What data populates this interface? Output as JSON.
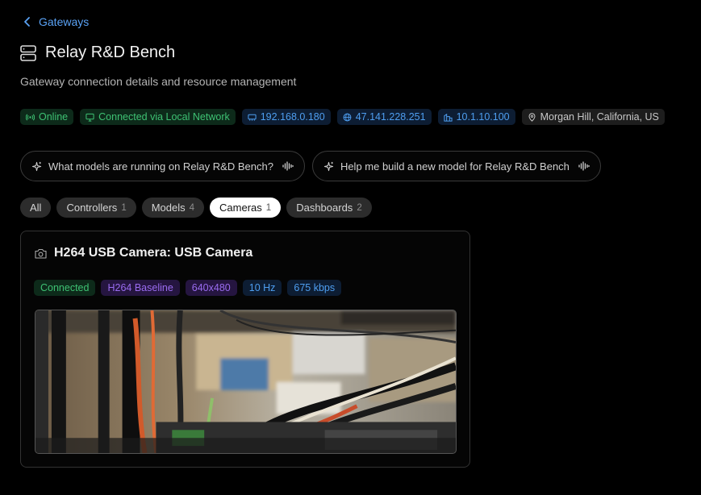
{
  "nav": {
    "back_label": "Gateways",
    "back_icon": "chevron-left-icon"
  },
  "header": {
    "title": "Relay R&D Bench",
    "icon": "server-icon",
    "subtitle": "Gateway connection details and resource management"
  },
  "status_badges": [
    {
      "label": "Online",
      "icon": "broadcast-icon",
      "color": "#3ec173"
    },
    {
      "label": "Connected via Local Network",
      "icon": "monitor-icon",
      "color": "#3ec173"
    },
    {
      "label": "192.168.0.180",
      "icon": "network-card-icon",
      "color": "#4e9ef0"
    },
    {
      "label": "47.141.228.251",
      "icon": "globe-icon",
      "color": "#4e9ef0"
    },
    {
      "label": "10.1.10.100",
      "icon": "building-icon",
      "color": "#4e9ef0"
    },
    {
      "label": "Morgan Hill, California, US",
      "icon": "map-pin-icon",
      "color": "#c8c8c8"
    }
  ],
  "prompts": [
    {
      "label": "What models are running on Relay R&D Bench?"
    },
    {
      "label": "Help me build a new model for Relay R&D Bench"
    }
  ],
  "tabs": [
    {
      "label": "All",
      "count": "",
      "active": false
    },
    {
      "label": "Controllers",
      "count": "1",
      "active": false
    },
    {
      "label": "Models",
      "count": "4",
      "active": false
    },
    {
      "label": "Cameras",
      "count": "1",
      "active": true
    },
    {
      "label": "Dashboards",
      "count": "2",
      "active": false
    }
  ],
  "camera_card": {
    "title": "H264 USB Camera: USB Camera",
    "icon": "camera-icon",
    "badges": [
      {
        "label": "Connected",
        "color": "#3ec173"
      },
      {
        "label": "H264 Baseline",
        "color": "#9a6cf0"
      },
      {
        "label": "640x480",
        "color": "#9a6cf0"
      },
      {
        "label": "10 Hz",
        "color": "#4e9ef0"
      },
      {
        "label": "675 kbps",
        "color": "#4e9ef0"
      }
    ]
  },
  "colors": {
    "accent": "#5aa2f5",
    "background": "#000000",
    "card_border": "#333333"
  }
}
